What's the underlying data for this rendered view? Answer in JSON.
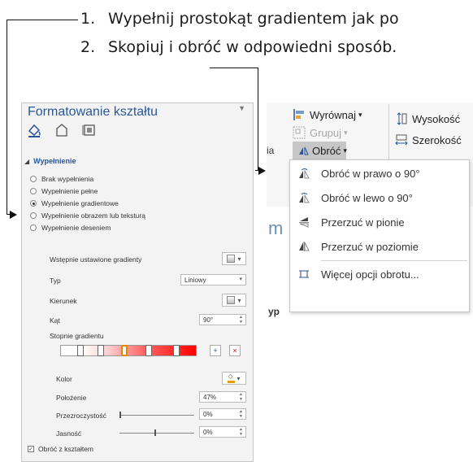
{
  "instructions": [
    {
      "number": "1.",
      "text": "Wypełnij prostokąt gradientem jak po"
    },
    {
      "number": "2.",
      "text": "Skopiuj i obróć w odpowiedni sposób."
    }
  ],
  "pane": {
    "title": "Formatowanie kształtu",
    "section": "Wypełnienie",
    "fill_options": [
      {
        "label": "Brak wypełnienia",
        "selected": false
      },
      {
        "label": "Wypełnienie pełne",
        "selected": false
      },
      {
        "label": "Wypełnienie gradientowe",
        "selected": true
      },
      {
        "label": "Wypełnienie obrazem lub teksturą",
        "selected": false
      },
      {
        "label": "Wypełnienie deseniem",
        "selected": false
      }
    ],
    "preset_label": "Wstępnie ustawione gradienty",
    "type_label": "Typ",
    "type_value": "Liniowy",
    "direction_label": "Kierunek",
    "angle_label": "Kąt",
    "angle_value": "90°",
    "stops_label": "Stopnie gradientu",
    "color_label": "Kolor",
    "position_label": "Położenie",
    "position_value": "47%",
    "transparency_label": "Przezroczystość",
    "transparency_value": "0%",
    "brightness_label": "Jasność",
    "brightness_value": "0%",
    "rotate_with_shape_label": "Obróć z kształtem",
    "rotate_with_shape_checked": true,
    "gradient_stops_positions": [
      0.15,
      0.3,
      0.47,
      0.65,
      0.85
    ]
  },
  "ribbon": {
    "align_label": "Wyrównaj",
    "group_label": "Grupuj",
    "rotate_label": "Obróć",
    "height_label": "Wysokość",
    "width_label": "Szerokość",
    "menu_items": [
      {
        "label": "Obróć w prawo o 90°",
        "icon": "rotate-right-icon"
      },
      {
        "label": "Obróć w lewo o 90°",
        "icon": "rotate-left-icon"
      },
      {
        "label": "Przerzuć w pionie",
        "icon": "flip-vertical-icon"
      },
      {
        "label": "Przerzuć w poziomie",
        "icon": "flip-horizontal-icon"
      },
      {
        "label": "Więcej opcji obrotu...",
        "icon": "more-rotation-icon"
      }
    ],
    "bg_fragment_1": "m",
    "bg_fragment_2": "yp",
    "bg_fragment_3": "ia"
  },
  "colors": {
    "accent": "#2b579a",
    "gradient_end": "#ff0000",
    "pane_bg": "#f3f3f3"
  }
}
